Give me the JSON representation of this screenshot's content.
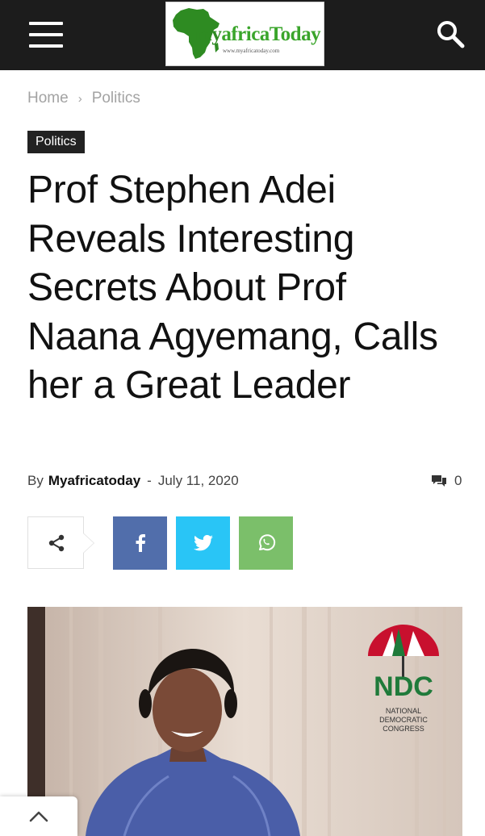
{
  "header": {
    "logo": {
      "text_part1": "my",
      "text_part2": "africaToday",
      "url": "www.myafricatoday.com"
    },
    "menu_icon": "hamburger-icon",
    "search_icon": "search-icon",
    "colors": {
      "bar": "#1c1c1c",
      "logo_green": "#2e8b22"
    }
  },
  "breadcrumb": {
    "home": "Home",
    "separator": "›",
    "current": "Politics"
  },
  "article": {
    "category": "Politics",
    "title": "Prof Stephen Adei Reveals Interesting Secrets About Prof Naana Agyemang, Calls her a Great Leader",
    "by_label": "By",
    "author": "Myafricatoday",
    "date_separator": "-",
    "date": "July 11, 2020",
    "comment_count": "0"
  },
  "share": {
    "share_icon": "share-icon",
    "facebook_icon": "facebook-icon",
    "twitter_icon": "twitter-icon",
    "whatsapp_icon": "whatsapp-icon",
    "colors": {
      "facebook": "#516eab",
      "twitter": "#29c5f6",
      "whatsapp": "#7bbf6a"
    }
  },
  "image": {
    "ndc_abbrev": "NDC",
    "ndc_line1": "NATIONAL",
    "ndc_line2": "DEMOCRATIC",
    "ndc_line3": "CONGRESS"
  },
  "back_to_top_icon": "chevron-up-icon"
}
